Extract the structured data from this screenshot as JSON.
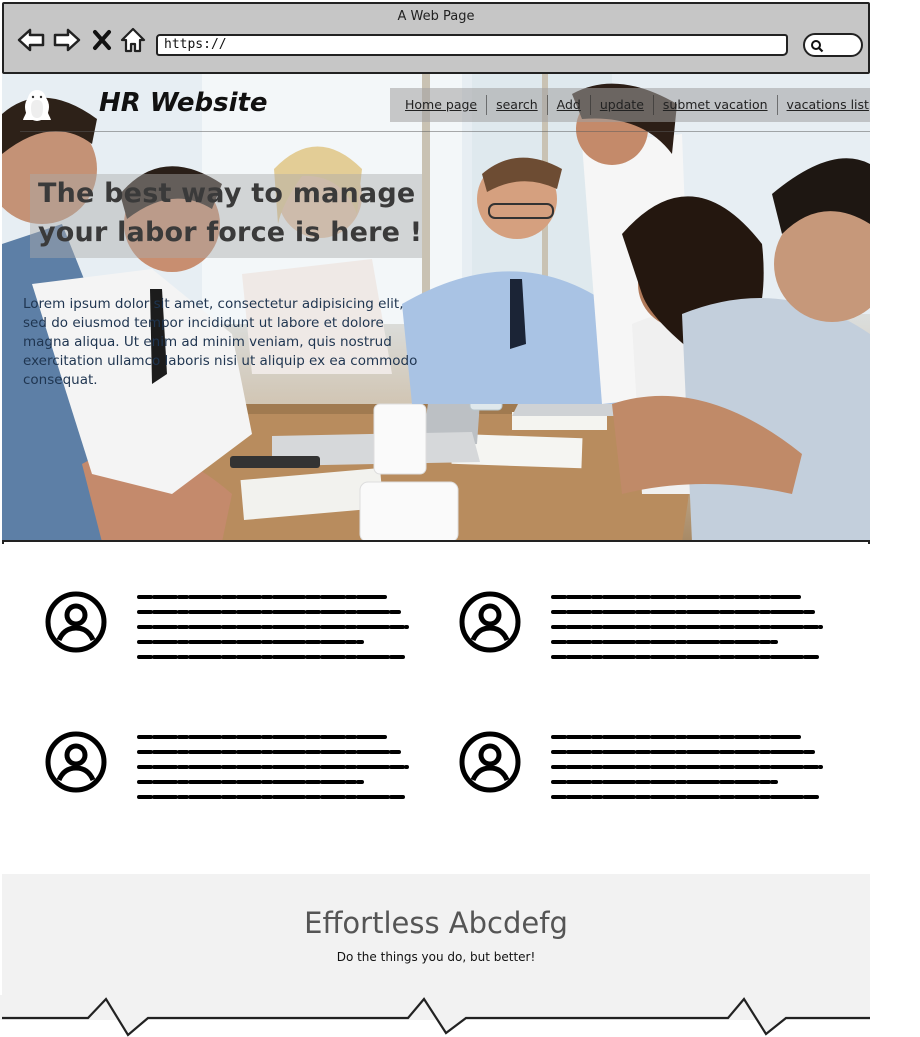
{
  "window": {
    "title": "A Web Page"
  },
  "browser": {
    "url": "https://",
    "icons": [
      "back-arrow-icon",
      "forward-arrow-icon",
      "close-x-icon",
      "home-icon",
      "search-icon"
    ]
  },
  "header": {
    "logo_icon": "penguin-logo-icon",
    "site_title": "HR Website",
    "nav": [
      {
        "label": "Home page"
      },
      {
        "label": "search"
      },
      {
        "label": "Add"
      },
      {
        "label": "update"
      },
      {
        "label": "submet vacation"
      },
      {
        "label": "vacations list"
      }
    ]
  },
  "hero": {
    "headline": "The best way to manage your labor force is here !",
    "body": "Lorem ipsum dolor sit amet, consectetur adipisicing elit, sed do eiusmod tempor incididunt ut labore et dolore magna aliqua. Ut enim ad minim veniam, quis nostrud exercitation ullamco laboris nisi ut aliquip ex ea commodo consequat.",
    "image": "team-meeting-photo"
  },
  "features": [
    {
      "icon": "user-avatar-icon"
    },
    {
      "icon": "user-avatar-icon"
    },
    {
      "icon": "user-avatar-icon"
    },
    {
      "icon": "user-avatar-icon"
    }
  ],
  "footer": {
    "title": "Effortless Abcdefg",
    "subtitle": "Do the things you do, but better!"
  },
  "colors": {
    "chrome": "#c6c6c6",
    "nav_overlay": "#a0a0a0",
    "body_text": "#1f3550",
    "footer_bg": "#f2f2f2"
  }
}
